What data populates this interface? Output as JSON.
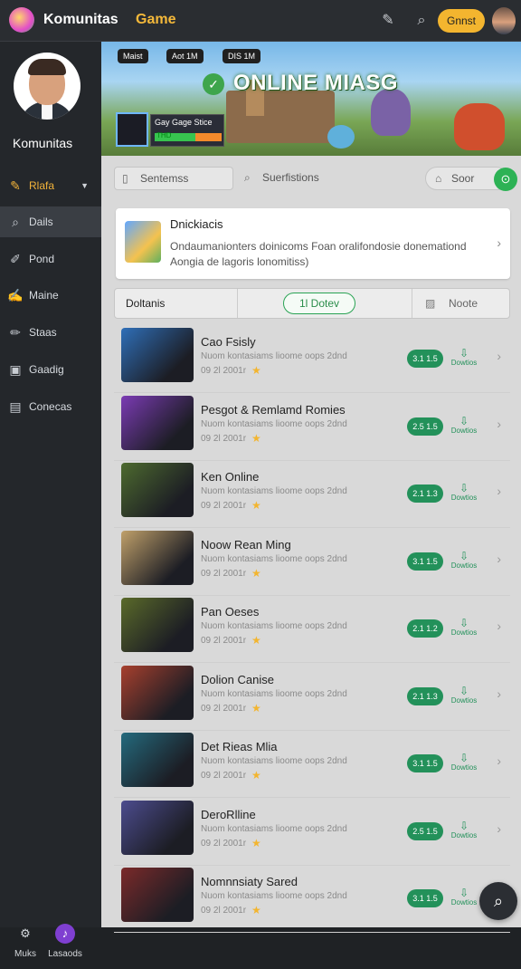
{
  "topbar": {
    "app_name": "Komunitas",
    "app_game": "Game",
    "button_label": "Gnnst",
    "icons": [
      "notification-icon",
      "search-icon",
      "user-avatar"
    ]
  },
  "sidebar": {
    "profile_name": "Komunitas",
    "items": [
      {
        "label": "Rlafa",
        "icon": "brush-icon"
      },
      {
        "label": "Dails",
        "icon": "search-icon"
      },
      {
        "label": "Pond",
        "icon": "pen-icon"
      },
      {
        "label": "Maine",
        "icon": "signature-icon"
      },
      {
        "label": "Staas",
        "icon": "pencil-icon"
      },
      {
        "label": "Gaadig",
        "icon": "grid-icon"
      },
      {
        "label": "Conecas",
        "icon": "card-icon"
      }
    ],
    "bottom": [
      {
        "label": "Muks",
        "icon": "gear-icon"
      },
      {
        "label": "Lasaods",
        "icon": "music-icon"
      }
    ]
  },
  "banner": {
    "chips": [
      "Maist",
      "Aot 1M",
      "DIS 1M"
    ],
    "title": "ONLINE MIASG",
    "stats_label": "Gay Gage Stice",
    "bar_label": "THD"
  },
  "filters": {
    "select_label": "Sentemss",
    "search_label": "Suerfistions",
    "sort_label": "Soor"
  },
  "notice": {
    "title": "Dnickiacis",
    "body": "Ondaumanionters doinicoms Foan oralifondosie donemationd Aongia de lagoris lonomitiss)"
  },
  "tabs": {
    "tab1": "Doltanis",
    "tab2": "1l Dotev",
    "tab3": "Noote"
  },
  "games": [
    {
      "title": "Cao Fsisly",
      "sub": "Nuom kontasiams lioome oops 2dnd",
      "date": "09 2l 2001r",
      "badge": "3.1 1.5",
      "dl": "Dowtios",
      "thumb": "#2f6fb8"
    },
    {
      "title": "Pesgot & Remlamd Romies",
      "sub": "Nuom kontasiams lioome oops 2dnd",
      "date": "09 2l 2001r",
      "badge": "2.5 1.5",
      "dl": "Dowtios",
      "thumb": "#7b3bb4"
    },
    {
      "title": "Ken Online",
      "sub": "Nuom kontasiams lioome oops 2dnd",
      "date": "09 2l 2001r",
      "badge": "2.1 1.3",
      "dl": "Dowtios",
      "thumb": "#4d6a2f"
    },
    {
      "title": "Noow Rean Ming",
      "sub": "Nuom kontasiams lioome oops 2dnd",
      "date": "09 2l 2001r",
      "badge": "3.1 1.5",
      "dl": "Dowtios",
      "thumb": "#c0a06a"
    },
    {
      "title": "Pan Oeses",
      "sub": "Nuom kontasiams lioome oops 2dnd",
      "date": "09 2l 2001r",
      "badge": "2.1 1.2",
      "dl": "Dowtios",
      "thumb": "#5a6a2a"
    },
    {
      "title": "Dolion Canise",
      "sub": "Nuom kontasiams lioome oops 2dnd",
      "date": "09 2l 2001r",
      "badge": "2.1 1.3",
      "dl": "Dowtios",
      "thumb": "#a7402e"
    },
    {
      "title": "Det Rieas Mlia",
      "sub": "Nuom kontasiams lioome oops 2dnd",
      "date": "09 2l 2001r",
      "badge": "3.1 1.5",
      "dl": "Dowtios",
      "thumb": "#246a7d"
    },
    {
      "title": "DeroRlline",
      "sub": "Nuom kontasiams lioome oops 2dnd",
      "date": "09 2l 2001r",
      "badge": "2.5 1.5",
      "dl": "Dowtios",
      "thumb": "#4c4c8e"
    },
    {
      "title": "Nomnnsiaty Sared",
      "sub": "Nuom kontasiams lioome oops 2dnd",
      "date": "09 2l 2001r",
      "badge": "3.1 1.5",
      "dl": "Dowtios",
      "thumb": "#7b2a2a"
    }
  ],
  "accent_colors": {
    "green": "#23915a",
    "yellow": "#f3b52f",
    "sidebar": "#24272b"
  }
}
